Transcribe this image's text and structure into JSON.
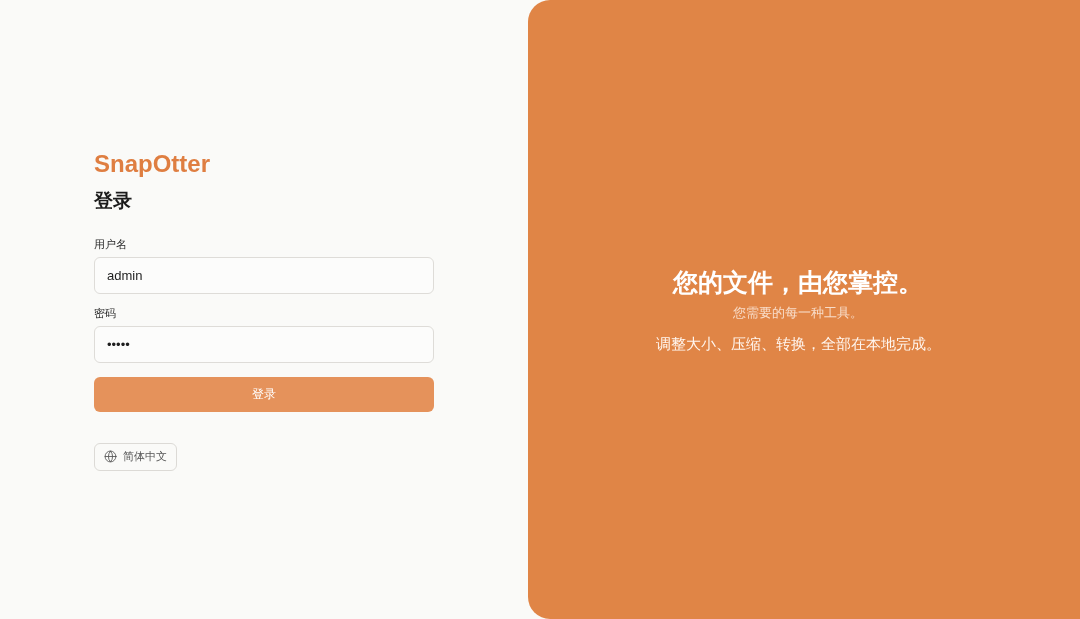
{
  "brand": {
    "name": "SnapOtter"
  },
  "login_form": {
    "title": "登录",
    "fields": [
      {
        "label": "用户名",
        "value": "admin"
      },
      {
        "label": "密码",
        "value": "•••••"
      }
    ],
    "submit": "登录",
    "language": "简体中文"
  },
  "hero": {
    "title": "您的文件，由您掌控。",
    "subtitle": "您需要的每一种工具。",
    "tagline": "调整大小、压缩、转换，全部在本地完成。"
  }
}
